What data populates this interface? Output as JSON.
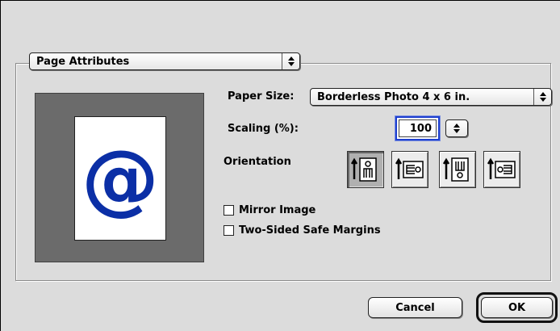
{
  "page_attributes_popup": {
    "label": "Page Attributes"
  },
  "paper_size": {
    "label": "Paper Size:",
    "value": "Borderless Photo 4 x 6 in."
  },
  "scaling": {
    "label": "Scaling (%):",
    "value": "100"
  },
  "orientation": {
    "label": "Orientation",
    "options": [
      "portrait",
      "landscape",
      "portrait-reversed",
      "landscape-reversed"
    ],
    "selected_index": 0
  },
  "preview": {
    "symbol": "@",
    "symbol_color": "#0b2fa6"
  },
  "checkboxes": {
    "mirror_image": {
      "label": "Mirror Image",
      "checked": false
    },
    "two_sided": {
      "label": "Two-Sided Safe Margins",
      "checked": false
    }
  },
  "buttons": {
    "cancel": "Cancel",
    "ok": "OK"
  }
}
